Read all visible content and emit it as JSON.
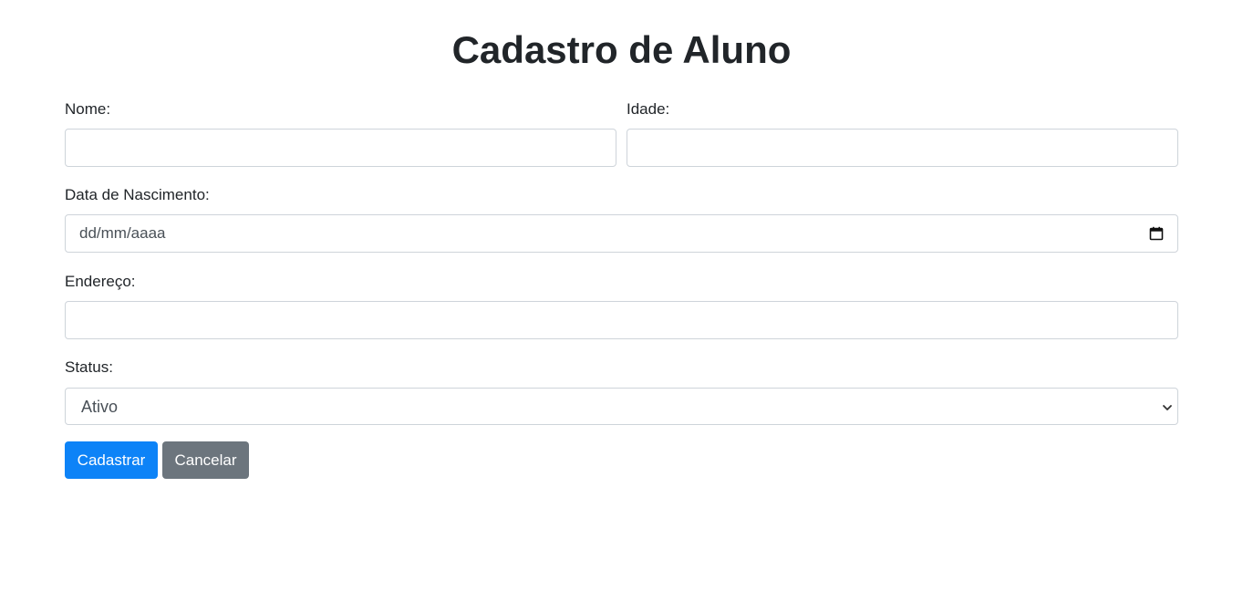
{
  "page": {
    "title": "Cadastro de Aluno"
  },
  "form": {
    "nome": {
      "label": "Nome:",
      "value": ""
    },
    "idade": {
      "label": "Idade:",
      "value": ""
    },
    "data_nascimento": {
      "label": "Data de Nascimento:",
      "placeholder": "dd/mm/aaaa"
    },
    "endereco": {
      "label": "Endereço:",
      "value": ""
    },
    "status": {
      "label": "Status:",
      "selected": "Ativo"
    }
  },
  "buttons": {
    "submit_label": "Cadastrar",
    "cancel_label": "Cancelar"
  },
  "colors": {
    "primary": "#0d83f7",
    "secondary": "#6c757d",
    "input_border": "#ced4da"
  },
  "icons": {
    "date": "calendar-icon",
    "select": "chevron-down-icon"
  }
}
